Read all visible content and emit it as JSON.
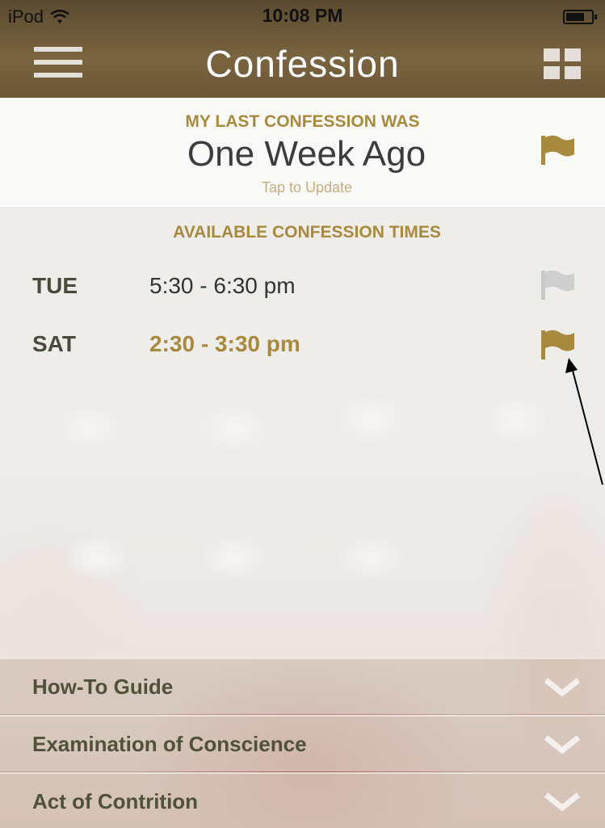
{
  "status_bar": {
    "carrier": "iPod",
    "time": "10:08 PM"
  },
  "header": {
    "title": "Confession"
  },
  "last_confession": {
    "label": "MY LAST CONFESSION WAS",
    "value": "One Week Ago",
    "hint": "Tap to Update"
  },
  "confession_times": {
    "label": "AVAILABLE CONFESSION TIMES",
    "items": [
      {
        "day": "TUE",
        "time": "5:30 - 6:30 pm",
        "flagged": false
      },
      {
        "day": "SAT",
        "time": "2:30 - 3:30 pm",
        "flagged": true
      }
    ]
  },
  "accordions": [
    {
      "label": "How-To Guide"
    },
    {
      "label": "Examination of Conscience"
    },
    {
      "label": "Act of Contrition"
    }
  ],
  "colors": {
    "accent_gold": "#a88a3e",
    "flag_inactive": "#c9c9c9",
    "section_text": "#4f5238"
  }
}
